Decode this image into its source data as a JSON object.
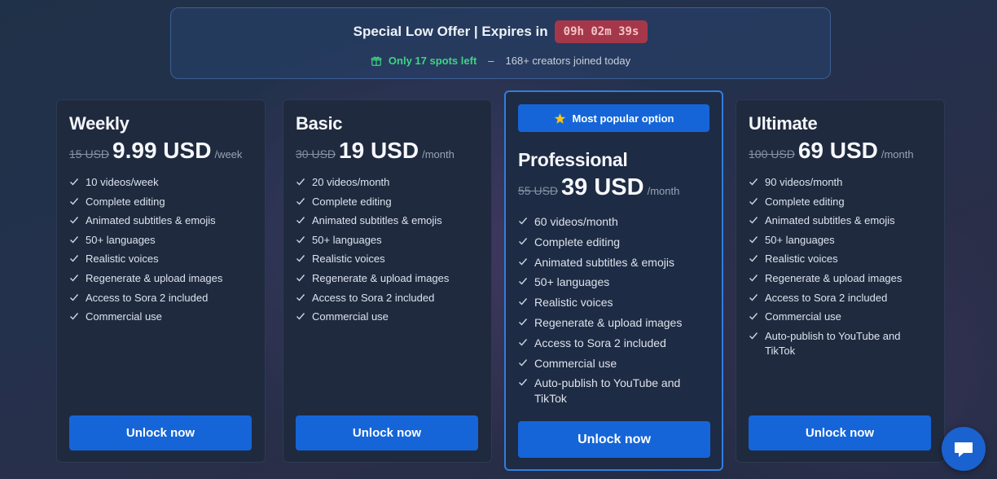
{
  "offer": {
    "title": "Special Low Offer | Expires in",
    "countdown": "09h 02m 39s",
    "spots_text": "Only 17 spots left",
    "separator": "–",
    "joined_text": "168+ creators joined today",
    "icon": "gift-icon"
  },
  "plans": [
    {
      "name": "Weekly",
      "old_price": "15 USD",
      "price": "9.99 USD",
      "period": "/week",
      "features": [
        "10 videos/week",
        "Complete editing",
        "Animated subtitles & emojis",
        "50+ languages",
        "Realistic voices",
        "Regenerate & upload images",
        "Access to Sora 2 included",
        "Commercial use"
      ],
      "button": "Unlock now"
    },
    {
      "name": "Basic",
      "old_price": "30 USD",
      "price": "19 USD",
      "period": "/month",
      "features": [
        "20 videos/month",
        "Complete editing",
        "Animated subtitles & emojis",
        "50+ languages",
        "Realistic voices",
        "Regenerate & upload images",
        "Access to Sora 2 included",
        "Commercial use"
      ],
      "button": "Unlock now"
    },
    {
      "name": "Professional",
      "badge": "Most popular option",
      "old_price": "55 USD",
      "price": "39 USD",
      "period": "/month",
      "features": [
        "60 videos/month",
        "Complete editing",
        "Animated subtitles & emojis",
        "50+ languages",
        "Realistic voices",
        "Regenerate & upload images",
        "Access to Sora 2 included",
        "Commercial use",
        "Auto-publish to YouTube and TikTok"
      ],
      "button": "Unlock now"
    },
    {
      "name": "Ultimate",
      "old_price": "100 USD",
      "price": "69 USD",
      "period": "/month",
      "features": [
        "90 videos/month",
        "Complete editing",
        "Animated subtitles & emojis",
        "50+ languages",
        "Realistic voices",
        "Regenerate & upload images",
        "Access to Sora 2 included",
        "Commercial use",
        "Auto-publish to YouTube and TikTok"
      ],
      "button": "Unlock now"
    }
  ],
  "colors": {
    "accent": "#1565d8",
    "countdown_bg": "#a4384a",
    "spots_green": "#3fd384",
    "star": "#f5c518"
  },
  "chat": {
    "icon": "chat-bubble-icon"
  }
}
